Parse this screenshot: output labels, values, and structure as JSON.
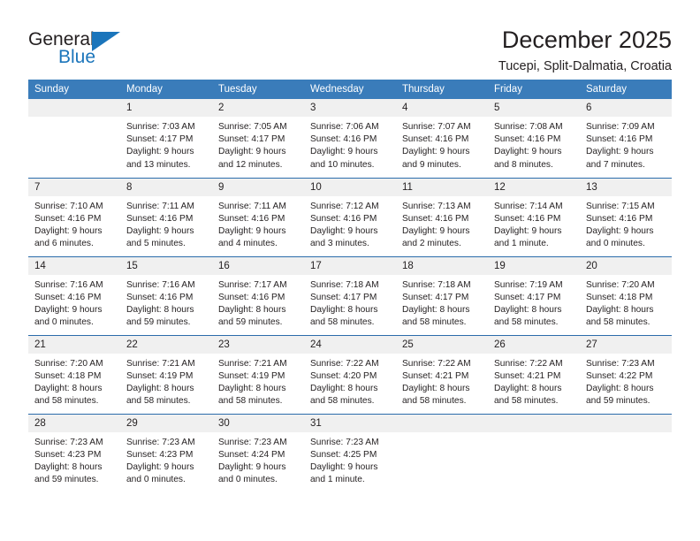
{
  "logo": {
    "word_one": "General",
    "word_two": "Blue",
    "triangle_color": "#1b75bb",
    "icon": "general-blue-logo"
  },
  "header": {
    "title": "December 2025",
    "location": "Tucepi, Split-Dalmatia, Croatia"
  },
  "calendar": {
    "weekday_headers": [
      "Sunday",
      "Monday",
      "Tuesday",
      "Wednesday",
      "Thursday",
      "Friday",
      "Saturday"
    ],
    "header_bg": "#3a7cba",
    "header_text_color": "#ffffff",
    "daynum_bg": "#f0f0f0",
    "week_divider_color": "#2b6cab",
    "weeks": [
      [
        {
          "day": "",
          "sunrise": "",
          "sunset": "",
          "daylight_line1": "",
          "daylight_line2": ""
        },
        {
          "day": "1",
          "sunrise": "Sunrise: 7:03 AM",
          "sunset": "Sunset: 4:17 PM",
          "daylight_line1": "Daylight: 9 hours",
          "daylight_line2": "and 13 minutes."
        },
        {
          "day": "2",
          "sunrise": "Sunrise: 7:05 AM",
          "sunset": "Sunset: 4:17 PM",
          "daylight_line1": "Daylight: 9 hours",
          "daylight_line2": "and 12 minutes."
        },
        {
          "day": "3",
          "sunrise": "Sunrise: 7:06 AM",
          "sunset": "Sunset: 4:16 PM",
          "daylight_line1": "Daylight: 9 hours",
          "daylight_line2": "and 10 minutes."
        },
        {
          "day": "4",
          "sunrise": "Sunrise: 7:07 AM",
          "sunset": "Sunset: 4:16 PM",
          "daylight_line1": "Daylight: 9 hours",
          "daylight_line2": "and 9 minutes."
        },
        {
          "day": "5",
          "sunrise": "Sunrise: 7:08 AM",
          "sunset": "Sunset: 4:16 PM",
          "daylight_line1": "Daylight: 9 hours",
          "daylight_line2": "and 8 minutes."
        },
        {
          "day": "6",
          "sunrise": "Sunrise: 7:09 AM",
          "sunset": "Sunset: 4:16 PM",
          "daylight_line1": "Daylight: 9 hours",
          "daylight_line2": "and 7 minutes."
        }
      ],
      [
        {
          "day": "7",
          "sunrise": "Sunrise: 7:10 AM",
          "sunset": "Sunset: 4:16 PM",
          "daylight_line1": "Daylight: 9 hours",
          "daylight_line2": "and 6 minutes."
        },
        {
          "day": "8",
          "sunrise": "Sunrise: 7:11 AM",
          "sunset": "Sunset: 4:16 PM",
          "daylight_line1": "Daylight: 9 hours",
          "daylight_line2": "and 5 minutes."
        },
        {
          "day": "9",
          "sunrise": "Sunrise: 7:11 AM",
          "sunset": "Sunset: 4:16 PM",
          "daylight_line1": "Daylight: 9 hours",
          "daylight_line2": "and 4 minutes."
        },
        {
          "day": "10",
          "sunrise": "Sunrise: 7:12 AM",
          "sunset": "Sunset: 4:16 PM",
          "daylight_line1": "Daylight: 9 hours",
          "daylight_line2": "and 3 minutes."
        },
        {
          "day": "11",
          "sunrise": "Sunrise: 7:13 AM",
          "sunset": "Sunset: 4:16 PM",
          "daylight_line1": "Daylight: 9 hours",
          "daylight_line2": "and 2 minutes."
        },
        {
          "day": "12",
          "sunrise": "Sunrise: 7:14 AM",
          "sunset": "Sunset: 4:16 PM",
          "daylight_line1": "Daylight: 9 hours",
          "daylight_line2": "and 1 minute."
        },
        {
          "day": "13",
          "sunrise": "Sunrise: 7:15 AM",
          "sunset": "Sunset: 4:16 PM",
          "daylight_line1": "Daylight: 9 hours",
          "daylight_line2": "and 0 minutes."
        }
      ],
      [
        {
          "day": "14",
          "sunrise": "Sunrise: 7:16 AM",
          "sunset": "Sunset: 4:16 PM",
          "daylight_line1": "Daylight: 9 hours",
          "daylight_line2": "and 0 minutes."
        },
        {
          "day": "15",
          "sunrise": "Sunrise: 7:16 AM",
          "sunset": "Sunset: 4:16 PM",
          "daylight_line1": "Daylight: 8 hours",
          "daylight_line2": "and 59 minutes."
        },
        {
          "day": "16",
          "sunrise": "Sunrise: 7:17 AM",
          "sunset": "Sunset: 4:16 PM",
          "daylight_line1": "Daylight: 8 hours",
          "daylight_line2": "and 59 minutes."
        },
        {
          "day": "17",
          "sunrise": "Sunrise: 7:18 AM",
          "sunset": "Sunset: 4:17 PM",
          "daylight_line1": "Daylight: 8 hours",
          "daylight_line2": "and 58 minutes."
        },
        {
          "day": "18",
          "sunrise": "Sunrise: 7:18 AM",
          "sunset": "Sunset: 4:17 PM",
          "daylight_line1": "Daylight: 8 hours",
          "daylight_line2": "and 58 minutes."
        },
        {
          "day": "19",
          "sunrise": "Sunrise: 7:19 AM",
          "sunset": "Sunset: 4:17 PM",
          "daylight_line1": "Daylight: 8 hours",
          "daylight_line2": "and 58 minutes."
        },
        {
          "day": "20",
          "sunrise": "Sunrise: 7:20 AM",
          "sunset": "Sunset: 4:18 PM",
          "daylight_line1": "Daylight: 8 hours",
          "daylight_line2": "and 58 minutes."
        }
      ],
      [
        {
          "day": "21",
          "sunrise": "Sunrise: 7:20 AM",
          "sunset": "Sunset: 4:18 PM",
          "daylight_line1": "Daylight: 8 hours",
          "daylight_line2": "and 58 minutes."
        },
        {
          "day": "22",
          "sunrise": "Sunrise: 7:21 AM",
          "sunset": "Sunset: 4:19 PM",
          "daylight_line1": "Daylight: 8 hours",
          "daylight_line2": "and 58 minutes."
        },
        {
          "day": "23",
          "sunrise": "Sunrise: 7:21 AM",
          "sunset": "Sunset: 4:19 PM",
          "daylight_line1": "Daylight: 8 hours",
          "daylight_line2": "and 58 minutes."
        },
        {
          "day": "24",
          "sunrise": "Sunrise: 7:22 AM",
          "sunset": "Sunset: 4:20 PM",
          "daylight_line1": "Daylight: 8 hours",
          "daylight_line2": "and 58 minutes."
        },
        {
          "day": "25",
          "sunrise": "Sunrise: 7:22 AM",
          "sunset": "Sunset: 4:21 PM",
          "daylight_line1": "Daylight: 8 hours",
          "daylight_line2": "and 58 minutes."
        },
        {
          "day": "26",
          "sunrise": "Sunrise: 7:22 AM",
          "sunset": "Sunset: 4:21 PM",
          "daylight_line1": "Daylight: 8 hours",
          "daylight_line2": "and 58 minutes."
        },
        {
          "day": "27",
          "sunrise": "Sunrise: 7:23 AM",
          "sunset": "Sunset: 4:22 PM",
          "daylight_line1": "Daylight: 8 hours",
          "daylight_line2": "and 59 minutes."
        }
      ],
      [
        {
          "day": "28",
          "sunrise": "Sunrise: 7:23 AM",
          "sunset": "Sunset: 4:23 PM",
          "daylight_line1": "Daylight: 8 hours",
          "daylight_line2": "and 59 minutes."
        },
        {
          "day": "29",
          "sunrise": "Sunrise: 7:23 AM",
          "sunset": "Sunset: 4:23 PM",
          "daylight_line1": "Daylight: 9 hours",
          "daylight_line2": "and 0 minutes."
        },
        {
          "day": "30",
          "sunrise": "Sunrise: 7:23 AM",
          "sunset": "Sunset: 4:24 PM",
          "daylight_line1": "Daylight: 9 hours",
          "daylight_line2": "and 0 minutes."
        },
        {
          "day": "31",
          "sunrise": "Sunrise: 7:23 AM",
          "sunset": "Sunset: 4:25 PM",
          "daylight_line1": "Daylight: 9 hours",
          "daylight_line2": "and 1 minute."
        },
        {
          "day": "",
          "sunrise": "",
          "sunset": "",
          "daylight_line1": "",
          "daylight_line2": ""
        },
        {
          "day": "",
          "sunrise": "",
          "sunset": "",
          "daylight_line1": "",
          "daylight_line2": ""
        },
        {
          "day": "",
          "sunrise": "",
          "sunset": "",
          "daylight_line1": "",
          "daylight_line2": ""
        }
      ]
    ]
  }
}
